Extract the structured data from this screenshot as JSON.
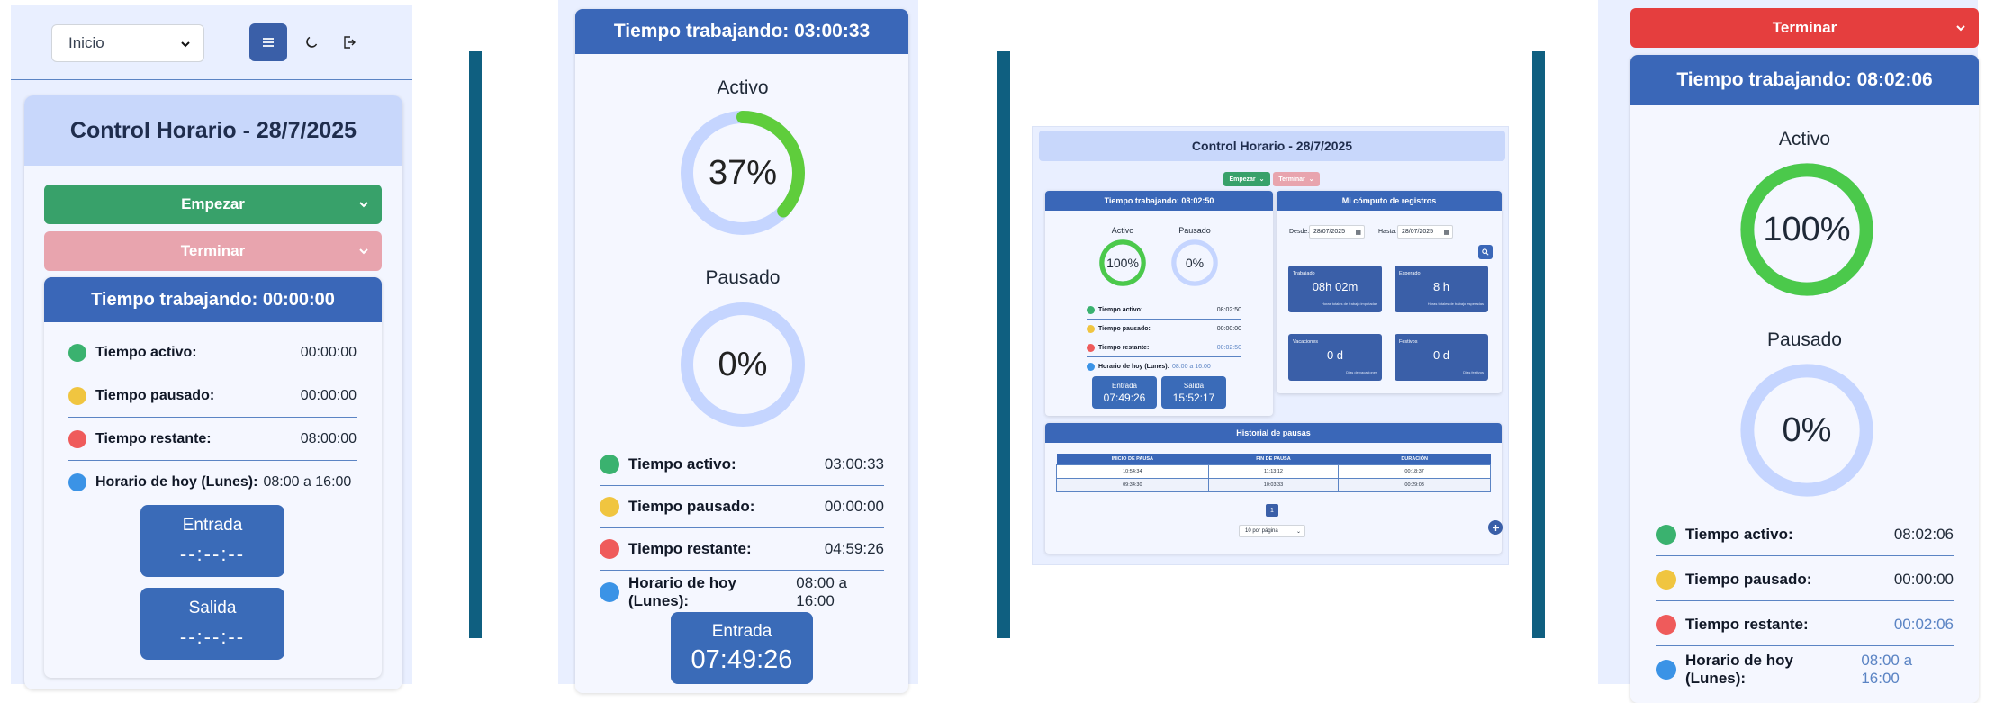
{
  "colors": {
    "accent": "#3a67b8",
    "green": "#3ba56a",
    "pink": "#e8a4ae",
    "red": "#e53e3e",
    "active": "#4bc94b",
    "light": "#c5d5ff",
    "dot_green": "#3ab26f",
    "dot_yellow": "#f0c540",
    "dot_red": "#ef5b5b",
    "dot_blue": "#3b93e6"
  },
  "p1": {
    "select_value": "Inicio",
    "title": "Control Horario - 28/7/2025",
    "start_btn": "Empezar",
    "end_btn": "Terminar",
    "work_header": "Tiempo trabajando: 00:00:00",
    "rows": [
      {
        "label": "Tiempo activo:",
        "value": "00:00:00"
      },
      {
        "label": "Tiempo pausado:",
        "value": "00:00:00"
      },
      {
        "label": "Tiempo restante:",
        "value": "08:00:00"
      },
      {
        "label": "Horario de hoy (Lunes):",
        "value": "08:00 a 16:00"
      }
    ],
    "entry_label": "Entrada",
    "entry_time": "--:--:--",
    "exit_label": "Salida",
    "exit_time": "--:--:--"
  },
  "p2": {
    "work_header": "Tiempo trabajando: 03:00:33",
    "active_label": "Activo",
    "active_pct": "37%",
    "active_fraction": 0.37,
    "paused_label": "Pausado",
    "paused_pct": "0%",
    "paused_fraction": 0,
    "rows": [
      {
        "label": "Tiempo activo:",
        "value": "03:00:33"
      },
      {
        "label": "Tiempo pausado:",
        "value": "00:00:00"
      },
      {
        "label": "Tiempo restante:",
        "value": "04:59:26"
      },
      {
        "label": "Horario de hoy (Lunes):",
        "value": "08:00 a 16:00"
      }
    ],
    "entry_label": "Entrada",
    "entry_time": "07:49:26"
  },
  "p3": {
    "title": "Control Horario - 28/7/2025",
    "start_btn": "Empezar",
    "end_btn": "Terminar",
    "work_header": "Tiempo trabajando: 08:02:50",
    "active_label": "Activo",
    "active_pct": "100%",
    "active_fraction": 1,
    "paused_label": "Pausado",
    "paused_pct": "0%",
    "paused_fraction": 0,
    "rows": [
      {
        "label": "Tiempo activo:",
        "value": "08:02:50"
      },
      {
        "label": "Tiempo pausado:",
        "value": "00:00:00"
      },
      {
        "label": "Tiempo restante:",
        "value": "00:02:50"
      },
      {
        "label": "Horario de hoy (Lunes):",
        "value": "08:00 a 16:00"
      }
    ],
    "entry_label": "Entrada",
    "entry_time": "07:49:26",
    "exit_label": "Salida",
    "exit_time": "15:52:17",
    "comp_header": "Mi cómputo de registros",
    "from_label": "Desde:",
    "from_value": "28/07/2025",
    "to_label": "Hasta:",
    "to_value": "28/07/2025",
    "stats": [
      {
        "title": "Trabajado",
        "value": "08h 02m",
        "sub": "Horas totales de trabajo imputadas"
      },
      {
        "title": "Esperado",
        "value": "8 h",
        "sub": "Horas totales de trabajo esperadas"
      },
      {
        "title": "Vacaciones",
        "value": "0 d",
        "sub": "Días de vacaciones"
      },
      {
        "title": "Festivos",
        "value": "0 d",
        "sub": "Días festivos"
      }
    ],
    "pause_header": "Historial de pausas",
    "table_headers": [
      "INICIO DE PAUSA",
      "FIN DE PAUSA",
      "DURACIÓN"
    ],
    "table_rows": [
      [
        "10:54:34",
        "11:13:12",
        "00:18:37"
      ],
      [
        "09:34:30",
        "10:03:33",
        "00:29:03"
      ]
    ],
    "page": "1",
    "per_page": "10 por página"
  },
  "p4": {
    "end_btn": "Terminar",
    "work_header": "Tiempo trabajando: 08:02:06",
    "active_label": "Activo",
    "active_pct": "100%",
    "active_fraction": 1,
    "paused_label": "Pausado",
    "paused_pct": "0%",
    "paused_fraction": 0,
    "rows": [
      {
        "label": "Tiempo activo:",
        "value": "08:02:06"
      },
      {
        "label": "Tiempo pausado:",
        "value": "00:00:00"
      },
      {
        "label": "Tiempo restante:",
        "value": "00:02:06"
      },
      {
        "label": "Horario de hoy (Lunes):",
        "value": "08:00 a 16:00"
      }
    ]
  }
}
